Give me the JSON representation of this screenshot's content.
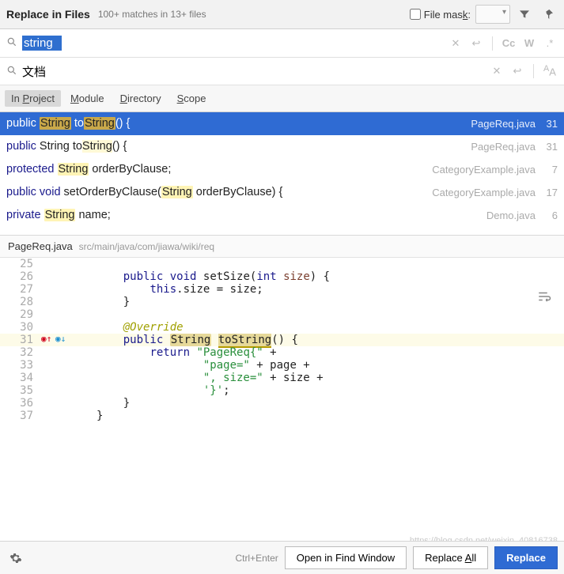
{
  "header": {
    "title": "Replace in Files",
    "stats": "100+ matches in 13+ files",
    "filemask_label_pre": "File mas",
    "filemask_label_key": "k",
    "filemask_label_post": ":"
  },
  "search": {
    "find_value": "string",
    "replace_value": "文档"
  },
  "row_opts": {
    "cc": "Cc",
    "w": "W",
    "regex": ".*",
    "aa": "A"
  },
  "scope": {
    "tabs": [
      {
        "label_pre": "In ",
        "label_u": "P",
        "label_post": "roject",
        "active": true
      },
      {
        "label_pre": "",
        "label_u": "M",
        "label_post": "odule",
        "active": false
      },
      {
        "label_pre": "",
        "label_u": "D",
        "label_post": "irectory",
        "active": false
      },
      {
        "label_pre": "",
        "label_u": "S",
        "label_post": "cope",
        "active": false
      }
    ]
  },
  "results": [
    {
      "file": "PageReq.java",
      "line": "31",
      "selected": true,
      "parts": [
        "public ",
        "HL:String",
        " to",
        "HL:String",
        "() {"
      ]
    },
    {
      "file": "PageReq.java",
      "line": "31",
      "selected": false,
      "dim": true,
      "parts": [
        "KW:public",
        " String to",
        "HLD:String",
        "() {"
      ]
    },
    {
      "file": "CategoryExample.java",
      "line": "7",
      "selected": false,
      "parts": [
        "KW:protected",
        " ",
        "HL:String",
        " orderByClause;"
      ]
    },
    {
      "file": "CategoryExample.java",
      "line": "17",
      "selected": false,
      "dim": true,
      "parts": [
        "KW:public",
        " ",
        "KW:void",
        " setOrderByClause(",
        "HL:String",
        " orderByClause) {"
      ]
    },
    {
      "file": "Demo.java",
      "line": "6",
      "selected": false,
      "parts": [
        "KW:private",
        " ",
        "HL:String",
        " name;"
      ]
    }
  ],
  "preview": {
    "filename": "PageReq.java",
    "filepath": "src/main/java/com/jiawa/wiki/req"
  },
  "editor": {
    "lines": [
      {
        "n": "25",
        "raw": ""
      },
      {
        "n": "26",
        "tokens": [
          "    ",
          "KW:public",
          " ",
          "KW:void",
          " ",
          "ID:setSize",
          "(",
          "KW:int",
          " ",
          "PR:size",
          ") {"
        ]
      },
      {
        "n": "27",
        "tokens": [
          "        ",
          "TH:this",
          ".size = size;"
        ]
      },
      {
        "n": "28",
        "tokens": [
          "    }"
        ]
      },
      {
        "n": "29",
        "tokens": [
          ""
        ]
      },
      {
        "n": "30",
        "tokens": [
          "    ",
          "AN:@Override"
        ]
      },
      {
        "n": "31",
        "hl": true,
        "marks": true,
        "tokens": [
          "    ",
          "KW:public",
          " ",
          "HL:String",
          " ",
          "HR:toString",
          "() {"
        ]
      },
      {
        "n": "32",
        "tokens": [
          "        ",
          "KW:return",
          " ",
          "ST:\"PageReq{\"",
          " +"
        ]
      },
      {
        "n": "33",
        "tokens": [
          "                ",
          "ST:\"page=\"",
          " + page +"
        ]
      },
      {
        "n": "34",
        "tokens": [
          "                ",
          "ST:\", size=\"",
          " + size +"
        ]
      },
      {
        "n": "35",
        "tokens": [
          "                ",
          "ST:'}'",
          ";"
        ]
      },
      {
        "n": "36",
        "tokens": [
          "    }"
        ]
      },
      {
        "n": "37",
        "tokens": [
          "}"
        ]
      }
    ]
  },
  "footer": {
    "hint": "Ctrl+Enter",
    "open": "Open in Find Window",
    "replace_all_pre": "Replace ",
    "replace_all_u": "A",
    "replace_all_post": "ll",
    "replace": "Replace"
  },
  "watermark": "https://blog.csdn.net/weixin_40816738"
}
